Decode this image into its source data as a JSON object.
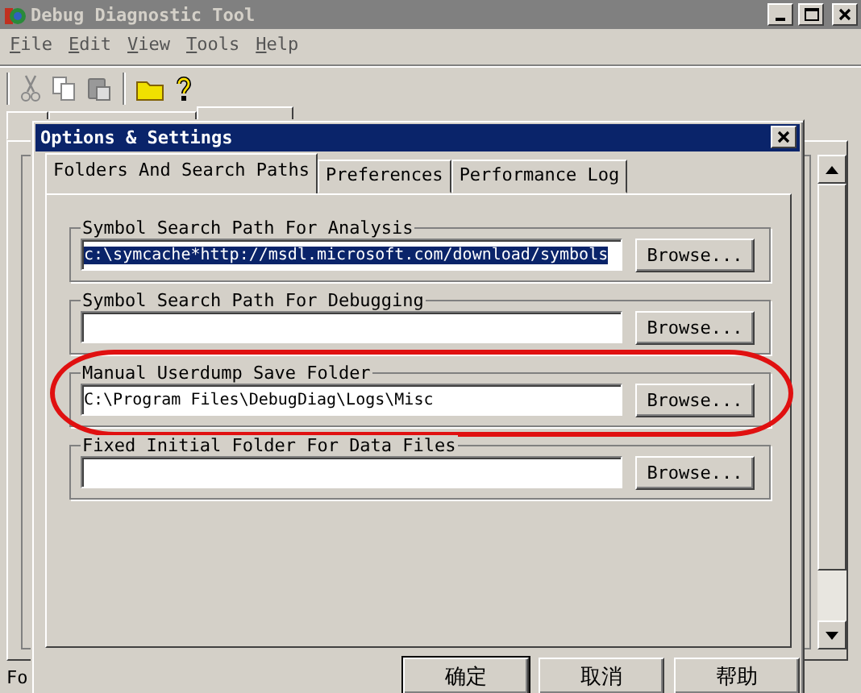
{
  "main_window": {
    "title": "Debug Diagnostic Tool",
    "menu": [
      {
        "label": "File"
      },
      {
        "label": "Edit"
      },
      {
        "label": "View"
      },
      {
        "label": "Tools"
      },
      {
        "label": "Help"
      }
    ],
    "tabs": [
      {
        "selected": false
      },
      {
        "selected": false
      },
      {
        "selected": true
      }
    ],
    "status_bar": "Fo"
  },
  "dialog": {
    "title": "Options & Settings",
    "tabs": [
      {
        "label": "Folders And Search Paths",
        "selected": true
      },
      {
        "label": "Preferences",
        "selected": false
      },
      {
        "label": "Performance Log",
        "selected": false
      }
    ],
    "groups": [
      {
        "label": "Symbol Search Path For Analysis",
        "value": "c:\\symcache*http://msdl.microsoft.com/download/symbols",
        "text_selected": true,
        "highlighted": false,
        "button": "Browse..."
      },
      {
        "label": "Symbol Search Path For Debugging",
        "highlighted": false,
        "button": "Browse..."
      },
      {
        "label": "Manual Userdump Save Folder",
        "value": "C:\\Program Files\\DebugDiag\\Logs\\Misc",
        "text_selected": false,
        "highlighted": true,
        "button": "Browse..."
      },
      {
        "label": "Fixed Initial Folder For Data Files",
        "highlighted": false,
        "button": "Browse..."
      }
    ],
    "buttons": [
      "确定",
      "取消",
      "帮助"
    ]
  }
}
